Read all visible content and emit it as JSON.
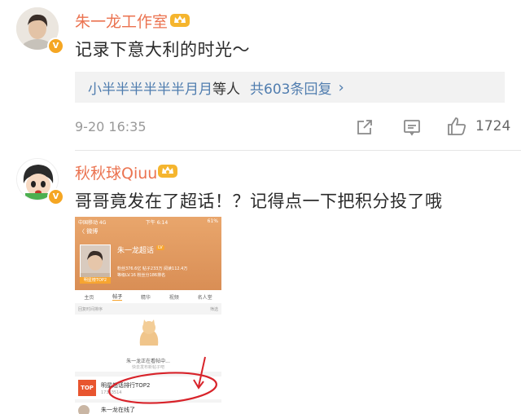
{
  "comment1": {
    "username": "朱一龙工作室",
    "text": "记录下意大利的时光～",
    "replies_names": "小半半半半半半月月",
    "replies_mid": "等人",
    "replies_count": "共603条回复",
    "time": "9-20 16:35",
    "likes": "1724",
    "avatar_badge": "V",
    "colors": {
      "username": "#eb7350",
      "link": "#507daf"
    }
  },
  "comment2": {
    "username": "秋秋球Qiuu",
    "text": "哥哥竟发在了超话！？记得点一下把积分投了哦",
    "avatar_badge": "V"
  },
  "embedded_screenshot": {
    "status_left": "中国移动 4G",
    "status_time": "下午 6:14",
    "status_right": "61%",
    "back_label": "〈 微博",
    "topic_title": "朱一龙超话",
    "topic_tag": "LV",
    "stats_line1": "粉丝376.6亿  帖子233万  阅读112.4万",
    "stats_line2": "等级LV.16  粉丝分186排名",
    "rank_label": "明星榜TOP2",
    "tabs": [
      "主页",
      "帖子",
      "精华",
      "视频",
      "名人堂"
    ],
    "active_tab": "帖子",
    "sub_left": "回复时间排序",
    "sub_right": "筛选",
    "loading_text": "朱一龙正在看帖中...",
    "loading_sub": "快去发布新帖子吧",
    "rank_badge": "TOP",
    "rank_text": "明星超话排行TOP2",
    "rank_sub": "17383514",
    "bottom_name": "朱一龙在线了"
  }
}
